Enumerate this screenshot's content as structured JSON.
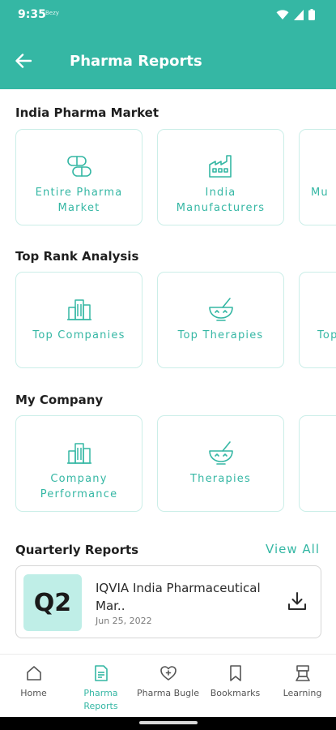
{
  "status_bar": {
    "time": "9:35",
    "small_text": "Bezy"
  },
  "header": {
    "title": "Pharma Reports"
  },
  "sections": {
    "india_pharma_market": {
      "title": "India Pharma Market",
      "cards": [
        {
          "label": "Entire Pharma Market",
          "icon": "pill-capsule-icon"
        },
        {
          "label": "India Manufacturers",
          "icon": "factory-icon"
        },
        {
          "label": "Mu",
          "icon": ""
        }
      ]
    },
    "top_rank_analysis": {
      "title": "Top Rank Analysis",
      "cards": [
        {
          "label": "Top Companies",
          "icon": "buildings-icon"
        },
        {
          "label": "Top Therapies",
          "icon": "mortar-pestle-icon"
        },
        {
          "label": "Top",
          "icon": ""
        }
      ]
    },
    "my_company": {
      "title": "My Company",
      "cards": [
        {
          "label": "Company Performance",
          "icon": "buildings-icon"
        },
        {
          "label": "Therapies",
          "icon": "mortar-pestle-icon"
        },
        {
          "label": "",
          "icon": ""
        }
      ]
    },
    "quarterly_reports": {
      "title": "Quarterly Reports",
      "view_all": "View All",
      "report": {
        "badge": "Q2",
        "title": "IQVIA India Pharmaceutical Mar..",
        "date": "Jun 25, 2022",
        "icon": "download-icon"
      }
    }
  },
  "bottom_nav": {
    "items": [
      {
        "label": "Home",
        "icon": "home-icon",
        "active": false
      },
      {
        "label": "Pharma Reports",
        "icon": "report-icon",
        "active": true
      },
      {
        "label": "Pharma Bugle",
        "icon": "heart-plus-icon",
        "active": false
      },
      {
        "label": "Bookmarks",
        "icon": "bookmark-icon",
        "active": false
      },
      {
        "label": "Learning",
        "icon": "learning-icon",
        "active": false
      }
    ]
  },
  "colors": {
    "primary": "#35b7a4",
    "card_border": "#cbeee8",
    "badge_bg": "#bfeee7"
  }
}
